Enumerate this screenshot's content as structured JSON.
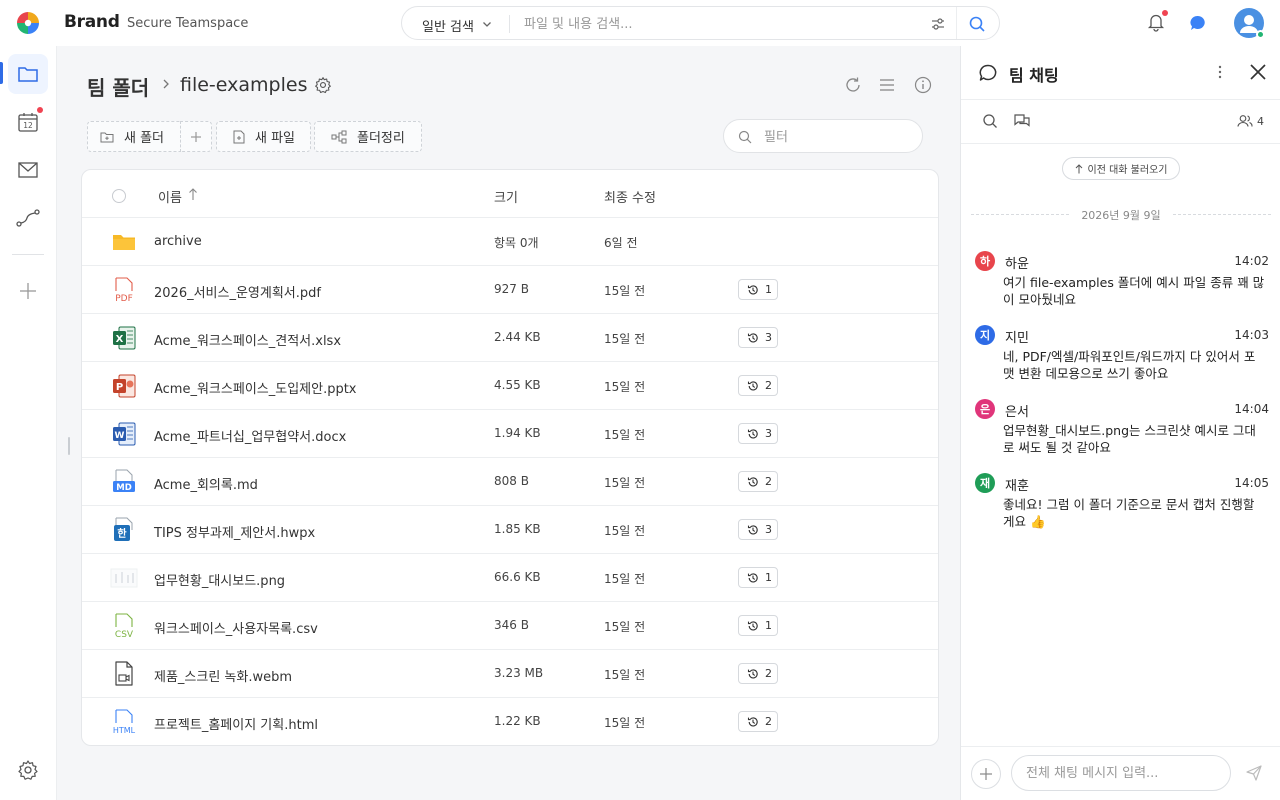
{
  "header": {
    "brand": "Brand",
    "workspace": "Secure Teamspace",
    "search_type": "일반 검색",
    "search_placeholder": "파일 및 내용 검색..."
  },
  "breadcrumb": {
    "root": "팀 폴더",
    "current": "file-examples"
  },
  "toolbar": {
    "new_folder": "새 폴더",
    "new_file": "새 파일",
    "organize": "폴더정리",
    "filter_placeholder": "필터"
  },
  "table": {
    "columns": {
      "name": "이름",
      "size": "크기",
      "modified": "최종 수정"
    },
    "rows": [
      {
        "icon": "folder-icon",
        "name": "archive",
        "size": "항목 0개",
        "modified": "6일 전",
        "versions": ""
      },
      {
        "icon": "pdf-icon",
        "name": "2026_서비스_운영계획서.pdf",
        "size": "927 B",
        "modified": "15일 전",
        "versions": "1"
      },
      {
        "icon": "excel-icon",
        "name": "Acme_워크스페이스_견적서.xlsx",
        "size": "2.44 KB",
        "modified": "15일 전",
        "versions": "3"
      },
      {
        "icon": "powerpoint-icon",
        "name": "Acme_워크스페이스_도입제안.pptx",
        "size": "4.55 KB",
        "modified": "15일 전",
        "versions": "2"
      },
      {
        "icon": "word-icon",
        "name": "Acme_파트너십_업무협약서.docx",
        "size": "1.94 KB",
        "modified": "15일 전",
        "versions": "3"
      },
      {
        "icon": "markdown-icon",
        "name": "Acme_회의록.md",
        "size": "808 B",
        "modified": "15일 전",
        "versions": "2"
      },
      {
        "icon": "hwp-icon",
        "name": "TIPS 정부과제_제안서.hwpx",
        "size": "1.85 KB",
        "modified": "15일 전",
        "versions": "3"
      },
      {
        "icon": "image-thumbnail-icon",
        "name": "업무현황_대시보드.png",
        "size": "66.6 KB",
        "modified": "15일 전",
        "versions": "1"
      },
      {
        "icon": "csv-icon",
        "name": "워크스페이스_사용자목록.csv",
        "size": "346 B",
        "modified": "15일 전",
        "versions": "1"
      },
      {
        "icon": "video-icon",
        "name": "제품_스크린 녹화.webm",
        "size": "3.23 MB",
        "modified": "15일 전",
        "versions": "2"
      },
      {
        "icon": "html-icon",
        "name": "프로젝트_홈페이지 기획.html",
        "size": "1.22 KB",
        "modified": "15일 전",
        "versions": "2"
      }
    ]
  },
  "chat": {
    "title": "팀 채팅",
    "member_count": "4",
    "load_previous": "이전 대화 불러오기",
    "date_divider": "2026년 9월 9일",
    "messages": [
      {
        "avatar": "하",
        "color": "#e8454c",
        "name": "하윤",
        "time": "14:02",
        "text": "여기 file-examples 폴더에 예시 파일 종류 꽤 많이 모아뒀네요"
      },
      {
        "avatar": "지",
        "color": "#2e6be6",
        "name": "지민",
        "time": "14:03",
        "text": "네, PDF/엑셀/파워포인트/워드까지 다 있어서 포맷 변환 데모용으로 쓰기 좋아요"
      },
      {
        "avatar": "은",
        "color": "#e0357a",
        "name": "은서",
        "time": "14:04",
        "text": "업무현황_대시보드.png는 스크린샷 예시로 그대로 써도 될 것 같아요"
      },
      {
        "avatar": "재",
        "color": "#1f9d57",
        "name": "재훈",
        "time": "14:05",
        "text": "좋네요! 그럼 이 폴더 기준으로 문서 캡처 진행할게요 👍"
      }
    ],
    "input_placeholder": "전체 채팅 메시지 입력..."
  }
}
